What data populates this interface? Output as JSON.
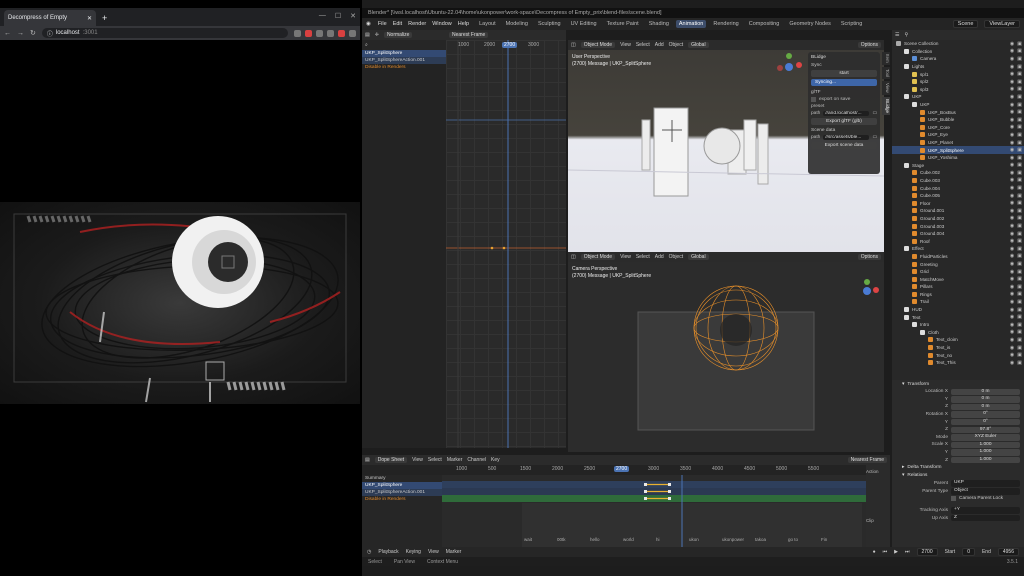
{
  "browser": {
    "tab_title": "Decompress of Empty",
    "url_host": "localhost",
    "url_port": ":3001"
  },
  "blender": {
    "title": "Blender* [\\\\wsl.localhost\\Ubuntu-22.04\\home\\ukonpower\\work-space\\Decompress of Empty_prix\\blend-files\\scene.blend]",
    "menus": [
      "File",
      "Edit",
      "Render",
      "Window",
      "Help"
    ],
    "workspaces": [
      "Layout",
      "Modeling",
      "Sculpting",
      "UV Editing",
      "Texture Paint",
      "Shading",
      "Animation",
      "Rendering",
      "Compositing",
      "Geometry Nodes",
      "Scripting"
    ],
    "active_workspace": "Animation",
    "scene": "Scene",
    "view_layer": "ViewLayer",
    "graph": {
      "mode": "Normalize",
      "interp": "Nearest Frame",
      "channels": [
        "UKP_SplitSphere",
        "UKP_SplitSphereAction.001",
        "Disable in Renders"
      ],
      "ruler": [
        "1000",
        "2000",
        "2700",
        "3000"
      ],
      "current": "2700"
    },
    "viewport_top": {
      "mode": "Object Mode",
      "menu": [
        "View",
        "Select",
        "Add",
        "Object"
      ],
      "orient": "Global",
      "options": "Options",
      "label1": "User Perspective",
      "label2": "(2700) Message | UKP_SplitSphere"
    },
    "viewport_bottom": {
      "mode": "Object Mode",
      "menu": [
        "View",
        "Select",
        "Add",
        "Object"
      ],
      "orient": "Global",
      "options": "Options",
      "label1": "Camera Perspective",
      "label2": "(2700) Message | UKP_SplitSphere"
    },
    "npanel": {
      "title": "BLidge",
      "sync": "Sync",
      "start": "start",
      "syncing": "Syncing...",
      "gltf": "glTF",
      "export_on_save": "export on save",
      "preset_label": "preset",
      "path_label": "path",
      "gltf_path": "//and.localhost/...",
      "export_gltf": "Export glTF (glb)",
      "scene_data": "Scene data",
      "scene_path": "//src/assets/ble...",
      "export_scene": "Export scene data",
      "tabs": [
        "Item",
        "Tool",
        "View",
        "BLidge"
      ]
    },
    "outliner": [
      {
        "name": "Scene Collection",
        "indent": 0,
        "color": "#aaa"
      },
      {
        "name": "Collection",
        "indent": 1,
        "color": "#ddd"
      },
      {
        "name": "Camera",
        "indent": 2,
        "color": "#5c8fd6"
      },
      {
        "name": "Lights",
        "indent": 1,
        "color": "#ddd"
      },
      {
        "name": "spl1",
        "indent": 2,
        "color": "#e0c050"
      },
      {
        "name": "spl2",
        "indent": 2,
        "color": "#e0c050"
      },
      {
        "name": "spl3",
        "indent": 2,
        "color": "#e0c050"
      },
      {
        "name": "UKP",
        "indent": 1,
        "color": "#ddd"
      },
      {
        "name": "UKP",
        "indent": 2,
        "color": "#ddd"
      },
      {
        "name": "UKP_BoxBus",
        "indent": 3,
        "color": "#e08a2d"
      },
      {
        "name": "UKP_Bubble",
        "indent": 3,
        "color": "#e08a2d"
      },
      {
        "name": "UKP_Core",
        "indent": 3,
        "color": "#e08a2d"
      },
      {
        "name": "UKP_Eye",
        "indent": 3,
        "color": "#e08a2d"
      },
      {
        "name": "UKP_Planet",
        "indent": 3,
        "color": "#e08a2d"
      },
      {
        "name": "UKP_SplitSphere",
        "indent": 3,
        "color": "#e08a2d",
        "sel": true
      },
      {
        "name": "UKP_Yoshima",
        "indent": 3,
        "color": "#e08a2d"
      },
      {
        "name": "Stage",
        "indent": 1,
        "color": "#ddd"
      },
      {
        "name": "Cube.002",
        "indent": 2,
        "color": "#e08a2d"
      },
      {
        "name": "Cube.003",
        "indent": 2,
        "color": "#e08a2d"
      },
      {
        "name": "Cube.004",
        "indent": 2,
        "color": "#e08a2d"
      },
      {
        "name": "Cube.005",
        "indent": 2,
        "color": "#e08a2d"
      },
      {
        "name": "Floor",
        "indent": 2,
        "color": "#e08a2d"
      },
      {
        "name": "Ground.001",
        "indent": 2,
        "color": "#e08a2d"
      },
      {
        "name": "Ground.002",
        "indent": 2,
        "color": "#e08a2d"
      },
      {
        "name": "Ground.003",
        "indent": 2,
        "color": "#e08a2d"
      },
      {
        "name": "Ground.004",
        "indent": 2,
        "color": "#e08a2d"
      },
      {
        "name": "Roof",
        "indent": 2,
        "color": "#e08a2d"
      },
      {
        "name": "Effect",
        "indent": 1,
        "color": "#ddd"
      },
      {
        "name": "FluidParticles",
        "indent": 2,
        "color": "#e08a2d"
      },
      {
        "name": "Greeting",
        "indent": 2,
        "color": "#e08a2d"
      },
      {
        "name": "Grid",
        "indent": 2,
        "color": "#e08a2d"
      },
      {
        "name": "MatchMove",
        "indent": 2,
        "color": "#e08a2d"
      },
      {
        "name": "Pillars",
        "indent": 2,
        "color": "#e08a2d"
      },
      {
        "name": "Rings",
        "indent": 2,
        "color": "#e08a2d"
      },
      {
        "name": "Trail",
        "indent": 2,
        "color": "#e08a2d"
      },
      {
        "name": "HUD",
        "indent": 1,
        "color": "#ddd"
      },
      {
        "name": "Text",
        "indent": 1,
        "color": "#ddd"
      },
      {
        "name": "Intro",
        "indent": 2,
        "color": "#ddd"
      },
      {
        "name": "Cloth",
        "indent": 3,
        "color": "#ddd"
      },
      {
        "name": "Text_cloim",
        "indent": 4,
        "color": "#e08a2d"
      },
      {
        "name": "Text_is",
        "indent": 4,
        "color": "#e08a2d"
      },
      {
        "name": "Text_no",
        "indent": 4,
        "color": "#e08a2d"
      },
      {
        "name": "Text_This",
        "indent": 4,
        "color": "#e08a2d"
      }
    ],
    "properties": {
      "transform": "Transform",
      "rows": [
        {
          "label": "Location X",
          "value": "0 m"
        },
        {
          "label": "Y",
          "value": "0 m"
        },
        {
          "label": "Z",
          "value": "0 m"
        },
        {
          "label": "Rotation X",
          "value": "0°"
        },
        {
          "label": "Y",
          "value": "0°"
        },
        {
          "label": "Z",
          "value": "97.8°"
        },
        {
          "label": "Mode",
          "value": "XYZ Euler"
        },
        {
          "label": "Scale X",
          "value": "1.000"
        },
        {
          "label": "Y",
          "value": "1.000"
        },
        {
          "label": "Z",
          "value": "1.000"
        }
      ],
      "delta": "Delta Transform",
      "relations": "Relations",
      "parent_label": "Parent",
      "parent_value": "UKP",
      "parent_type_label": "Parent Type",
      "parent_type_value": "Object",
      "camera_lock": "Camera Parent Lock",
      "tracking_label": "Tracking Axis",
      "tracking_value": "+Y",
      "up_label": "Up Axis",
      "up_value": "Z"
    },
    "dope": {
      "editor": "Dope Sheet",
      "menu": [
        "View",
        "Select",
        "Marker",
        "Channel",
        "Key"
      ],
      "interp": "Nearest Frame",
      "ruler": [
        "1000",
        "500",
        "1500",
        "2000",
        "2500",
        "2700",
        "3000",
        "3500",
        "4000",
        "4500",
        "5000",
        "5500"
      ],
      "channels": [
        "Summary",
        "UKP_SplitSphere",
        "UKP_SplitSphereAction.001",
        "Disable in Renders"
      ],
      "markers": [
        "wait",
        "00tk",
        "hello",
        "world",
        "hi",
        "ukon",
        "ukonpower",
        "takoa",
        "go to",
        "Fin"
      ],
      "side": [
        "Action",
        "Clip"
      ]
    },
    "timeline": {
      "items": [
        "Playback",
        "Keying",
        "View",
        "Marker"
      ],
      "frame": "2700",
      "start_label": "Start",
      "start": "0",
      "end_label": "End",
      "end": "4956"
    },
    "status": [
      "Select",
      "Pan View",
      "Context Menu"
    ],
    "version": "3.5.1"
  }
}
